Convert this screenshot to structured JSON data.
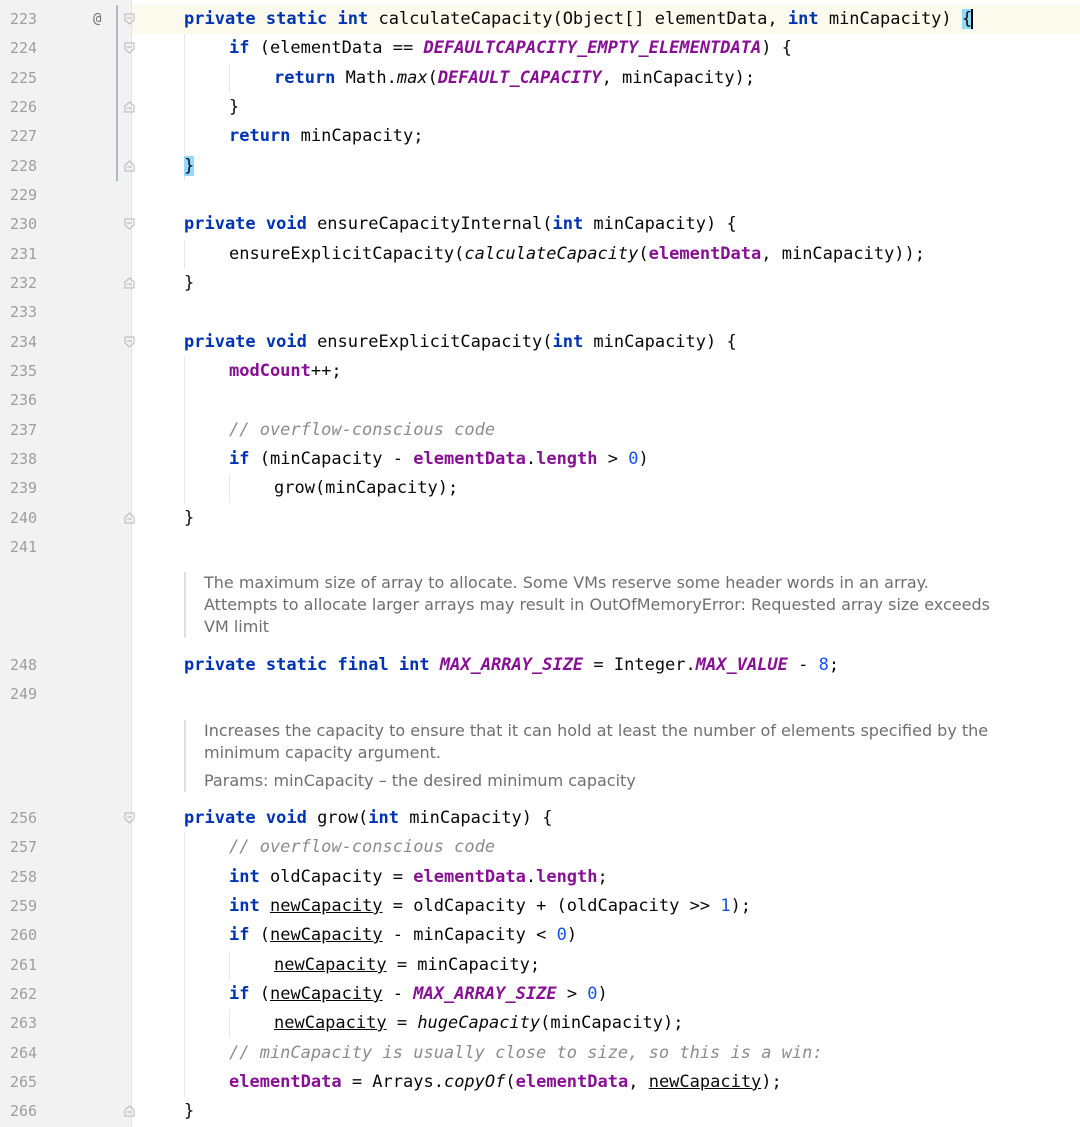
{
  "gutter": {
    "line_numbers": [
      "223",
      "224",
      "225",
      "226",
      "227",
      "228",
      "229",
      "230",
      "231",
      "232",
      "233",
      "234",
      "235",
      "236",
      "237",
      "238",
      "239",
      "240",
      "241",
      "248",
      "249",
      "256",
      "257",
      "258",
      "259",
      "260",
      "261",
      "262",
      "263",
      "264",
      "265",
      "266"
    ],
    "override_marker": "@"
  },
  "code": {
    "l223": {
      "p1": "private static int ",
      "p2": "calculateCapacity(Object[] elementData, ",
      "p3": "int ",
      "p4": "minCapacity) ",
      "p5": "{"
    },
    "l224": {
      "p1": "if ",
      "p2": "(elementData == ",
      "p3": "DEFAULTCAPACITY_EMPTY_ELEMENTDATA",
      "p4": ") {"
    },
    "l225": {
      "p1": "return ",
      "p2": "Math.",
      "p3": "max",
      "p4": "(",
      "p5": "DEFAULT_CAPACITY",
      "p6": ", minCapacity);"
    },
    "l226": {
      "p1": "}"
    },
    "l227": {
      "p1": "return ",
      "p2": "minCapacity;"
    },
    "l228": {
      "p1": "}"
    },
    "l230": {
      "p1": "private void ",
      "p2": "ensureCapacityInternal(",
      "p3": "int ",
      "p4": "minCapacity) {"
    },
    "l231": {
      "p1": "ensureExplicitCapacity(",
      "p2": "calculateCapacity",
      "p3": "(",
      "p4": "elementData",
      "p5": ", minCapacity));"
    },
    "l232": {
      "p1": "}"
    },
    "l234": {
      "p1": "private void ",
      "p2": "ensureExplicitCapacity(",
      "p3": "int ",
      "p4": "minCapacity) {"
    },
    "l235": {
      "p1": "modCount",
      "p2": "++;"
    },
    "l237": {
      "p1": "// overflow-conscious code"
    },
    "l238": {
      "p1": "if ",
      "p2": "(minCapacity - ",
      "p3": "elementData",
      "p4": ".",
      "p5": "length",
      "p6": " > ",
      "p7": "0",
      "p8": ")"
    },
    "l239": {
      "p1": "grow(minCapacity);"
    },
    "l240": {
      "p1": "}"
    },
    "l248": {
      "p1": "private static final int ",
      "p2": "MAX_ARRAY_SIZE",
      "p3": " = Integer.",
      "p4": "MAX_VALUE",
      "p5": " - ",
      "p6": "8",
      "p7": ";"
    },
    "l256": {
      "p1": "private void ",
      "p2": "grow(",
      "p3": "int ",
      "p4": "minCapacity) {"
    },
    "l257": {
      "p1": "// overflow-conscious code"
    },
    "l258": {
      "p1": "int ",
      "p2": "oldCapacity = ",
      "p3": "elementData",
      "p4": ".",
      "p5": "length",
      "p6": ";"
    },
    "l259": {
      "p1": "int ",
      "p2": "newCapacity",
      "p3": " = oldCapacity + (oldCapacity >> ",
      "p4": "1",
      "p5": ");"
    },
    "l260": {
      "p1": "if ",
      "p2": "(",
      "p3": "newCapacity",
      "p4": " - minCapacity < ",
      "p5": "0",
      "p6": ")"
    },
    "l261": {
      "p1": "newCapacity",
      "p2": " = minCapacity;"
    },
    "l262": {
      "p1": "if ",
      "p2": "(",
      "p3": "newCapacity",
      "p4": " - ",
      "p5": "MAX_ARRAY_SIZE",
      "p6": " > ",
      "p7": "0",
      "p8": ")"
    },
    "l263": {
      "p1": "newCapacity",
      "p2": " = ",
      "p3": "hugeCapacity",
      "p4": "(minCapacity);"
    },
    "l264": {
      "p1": "// minCapacity is usually close to size, so this is a win:"
    },
    "l265": {
      "p1": "elementData",
      "p2": " = Arrays.",
      "p3": "copyOf",
      "p4": "(",
      "p5": "elementData",
      "p6": ", ",
      "p7": "newCapacity",
      "p8": ");"
    },
    "l266": {
      "p1": "}"
    }
  },
  "docs": {
    "max_array_size": {
      "line1": "The maximum size of array to allocate. Some VMs reserve some header words in an array.",
      "line2": "Attempts to allocate larger arrays may result in OutOfMemoryError: Requested array size exceeds",
      "line3": "VM limit"
    },
    "grow": {
      "line1": "Increases the capacity to ensure that it can hold at least the number of elements specified by the",
      "line2": "minimum capacity argument.",
      "params": "Params: minCapacity – the desired minimum capacity"
    }
  },
  "colors": {
    "keyword": "#0033b3",
    "field": "#871094",
    "comment": "#8c8c8c",
    "number": "#1750eb",
    "brace_match": "#93d9ff",
    "current_line": "#fcfaed",
    "gutter": "#f2f2f2"
  },
  "icons": {
    "override": "override-marker-icon",
    "fold": "fold-marker-icon"
  }
}
